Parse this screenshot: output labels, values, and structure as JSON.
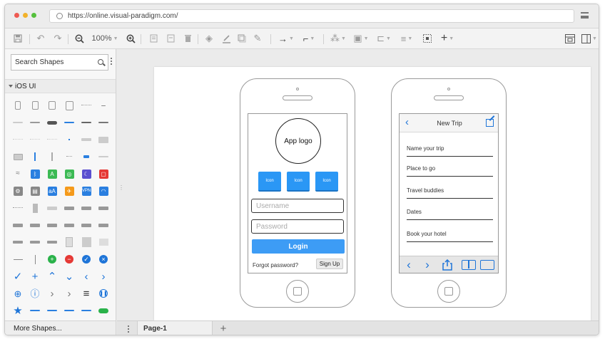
{
  "browser": {
    "url": "https://online.visual-paradigm.com/"
  },
  "toolbar": {
    "zoom": "100%"
  },
  "left_panel": {
    "search_placeholder": "Search Shapes",
    "section_label": "iOS UI",
    "more_shapes": "More Shapes..."
  },
  "login_screen": {
    "logo_label": "App logo",
    "icons": [
      "Icon",
      "Icon",
      "Icon"
    ],
    "username_placeholder": "Username",
    "password_placeholder": "Password",
    "login_label": "Login",
    "forgot_label": "Forgot password?",
    "signup_label": "Sign Up"
  },
  "trip_screen": {
    "title": "New Trip",
    "fields": [
      "Name your trip",
      "Place to go",
      "Travel buddies",
      "Dates",
      "Book your hotel"
    ]
  },
  "pages": {
    "current": "Page-1"
  },
  "colors": {
    "accent": "#2a97f5",
    "ios_blue": "#1f75d8",
    "login_button": "#3d9cf5"
  }
}
